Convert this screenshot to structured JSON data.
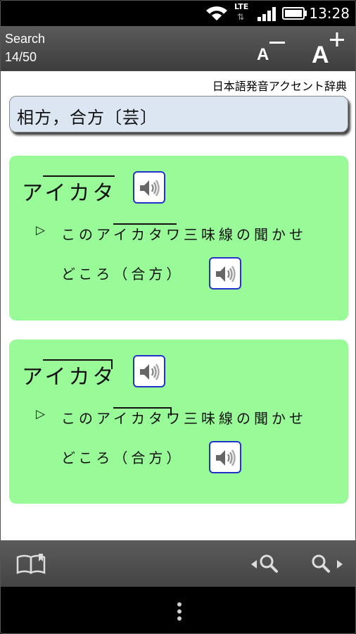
{
  "status_bar": {
    "time": "13:28",
    "network": "LTE",
    "icons": [
      "wifi-icon",
      "lte-icon",
      "signal-icon",
      "battery-icon"
    ]
  },
  "action_bar": {
    "title": "Search",
    "counter": "14/50",
    "font_decrease": "A−",
    "font_increase": "A+"
  },
  "dictionary_name": "日本語発音アクセント辞典",
  "headword": "相方，合方〔芸〕",
  "entries": [
    {
      "reading": "アイカタ",
      "accent": "flat",
      "example_line1": "このアイカタワ三味線の聞かせ",
      "example_line2": "どころ（合方）"
    },
    {
      "reading": "アイカタ",
      "accent": "drop-after-ta",
      "example_line1": "このアイカタワ三味線の聞かせ",
      "example_line2": "どころ（合方）"
    }
  ],
  "icons": {
    "sound": "speaker-icon",
    "example_marker": "▷",
    "toolbar": [
      "book-icon",
      "search-previous-icon",
      "search-next-icon"
    ],
    "nav": "overflow-menu-icon"
  },
  "colors": {
    "card_background": "#98fb98",
    "headword_background": "#dce6f2",
    "sound_border": "#2233cc",
    "action_bar": "#4a4a4a"
  }
}
